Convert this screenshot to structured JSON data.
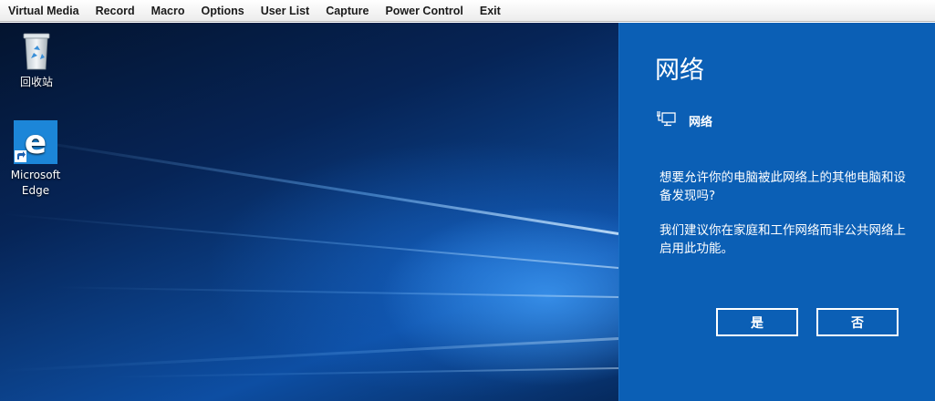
{
  "menubar": {
    "items": [
      "Virtual Media",
      "Record",
      "Macro",
      "Options",
      "User List",
      "Capture",
      "Power Control",
      "Exit"
    ]
  },
  "desktop": {
    "icons": [
      {
        "label": "回收站",
        "icon": "recycle-bin-icon"
      },
      {
        "label": "Microsoft Edge",
        "icon": "edge-icon"
      }
    ]
  },
  "network_panel": {
    "title": "网络",
    "network_name": "网络",
    "network_icon": "network-monitor-icon",
    "question": "想要允许你的电脑被此网络上的其他电脑和设备发现吗?",
    "recommendation": "我们建议你在家庭和工作网络而非公共网络上启用此功能。",
    "yes_label": "是",
    "no_label": "否",
    "background_color": "#0b5fb5"
  }
}
